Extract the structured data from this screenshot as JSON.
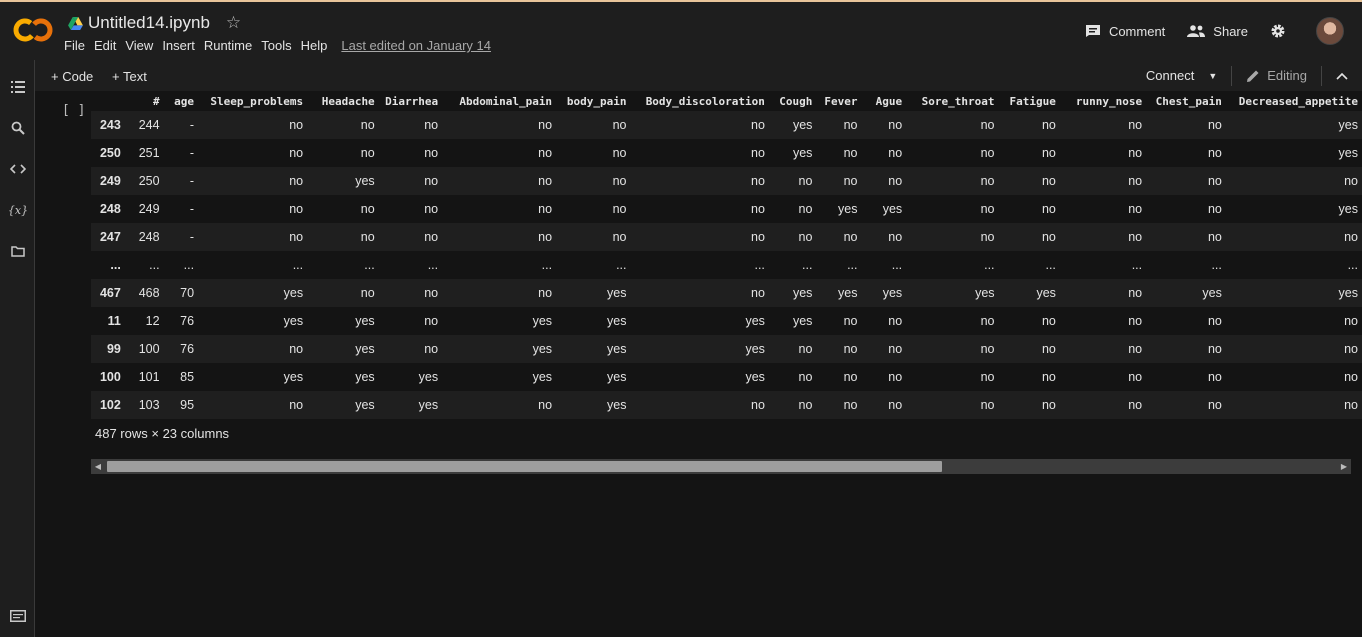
{
  "app": {
    "logo": "colab-logo-icon",
    "drive_icon": "drive-icon",
    "filename": "Untitled14.ipynb",
    "star_icon": "star-icon",
    "menu": [
      "File",
      "Edit",
      "View",
      "Insert",
      "Runtime",
      "Tools",
      "Help"
    ],
    "last_edited": "Last edited on January 14",
    "comment_label": "Comment",
    "share_label": "Share",
    "settings_icon": "gear-icon"
  },
  "sidebar": {
    "icons": [
      "table-of-contents-icon",
      "search-icon",
      "code-snippets-icon",
      "variables-icon",
      "files-icon"
    ],
    "footer_icon": "terminal-icon"
  },
  "toolbar": {
    "code_label": "+ Code",
    "text_label": "+ Text",
    "connect_label": "Connect",
    "editing_label": "Editing"
  },
  "cell": {
    "run_indicator": "[ ]"
  },
  "dataframe": {
    "columns": [
      "",
      "#",
      "age",
      "Sleep_problems",
      "Headache",
      "Diarrhea",
      "Abdominal_pain",
      "body_pain",
      "Body_discoloration",
      "Cough",
      "Fever",
      "Ague",
      "Sore_throat",
      "Fatigue",
      "runny_nose",
      "Chest_pain",
      "Decreased_appetite"
    ],
    "rows": [
      [
        "243",
        "244",
        "-",
        "no",
        "no",
        "no",
        "no",
        "no",
        "no",
        "yes",
        "no",
        "no",
        "no",
        "no",
        "no",
        "no",
        "yes"
      ],
      [
        "250",
        "251",
        "-",
        "no",
        "no",
        "no",
        "no",
        "no",
        "no",
        "yes",
        "no",
        "no",
        "no",
        "no",
        "no",
        "no",
        "yes"
      ],
      [
        "249",
        "250",
        "-",
        "no",
        "yes",
        "no",
        "no",
        "no",
        "no",
        "no",
        "no",
        "no",
        "no",
        "no",
        "no",
        "no",
        "no"
      ],
      [
        "248",
        "249",
        "-",
        "no",
        "no",
        "no",
        "no",
        "no",
        "no",
        "no",
        "yes",
        "yes",
        "no",
        "no",
        "no",
        "no",
        "yes"
      ],
      [
        "247",
        "248",
        "-",
        "no",
        "no",
        "no",
        "no",
        "no",
        "no",
        "no",
        "no",
        "no",
        "no",
        "no",
        "no",
        "no",
        "no"
      ],
      [
        "...",
        "...",
        "...",
        "...",
        "...",
        "...",
        "...",
        "...",
        "...",
        "...",
        "...",
        "...",
        "...",
        "...",
        "...",
        "...",
        "..."
      ],
      [
        "467",
        "468",
        "70",
        "yes",
        "no",
        "no",
        "no",
        "yes",
        "no",
        "yes",
        "yes",
        "yes",
        "yes",
        "yes",
        "no",
        "yes",
        "yes"
      ],
      [
        "11",
        "12",
        "76",
        "yes",
        "yes",
        "no",
        "yes",
        "yes",
        "yes",
        "yes",
        "no",
        "no",
        "no",
        "no",
        "no",
        "no",
        "no"
      ],
      [
        "99",
        "100",
        "76",
        "no",
        "yes",
        "no",
        "yes",
        "yes",
        "yes",
        "no",
        "no",
        "no",
        "no",
        "no",
        "no",
        "no",
        "no"
      ],
      [
        "100",
        "101",
        "85",
        "yes",
        "yes",
        "yes",
        "yes",
        "yes",
        "yes",
        "no",
        "no",
        "no",
        "no",
        "no",
        "no",
        "no",
        "no"
      ],
      [
        "102",
        "103",
        "95",
        "no",
        "yes",
        "yes",
        "no",
        "yes",
        "no",
        "no",
        "no",
        "no",
        "no",
        "no",
        "no",
        "no",
        "no"
      ]
    ],
    "shape": "487 rows × 23 columns"
  },
  "colors": {
    "accent_orange": "#f9ab00",
    "logo_orange": "#e8710a",
    "background": "#1e1e1e",
    "output_bg": "#141414"
  }
}
